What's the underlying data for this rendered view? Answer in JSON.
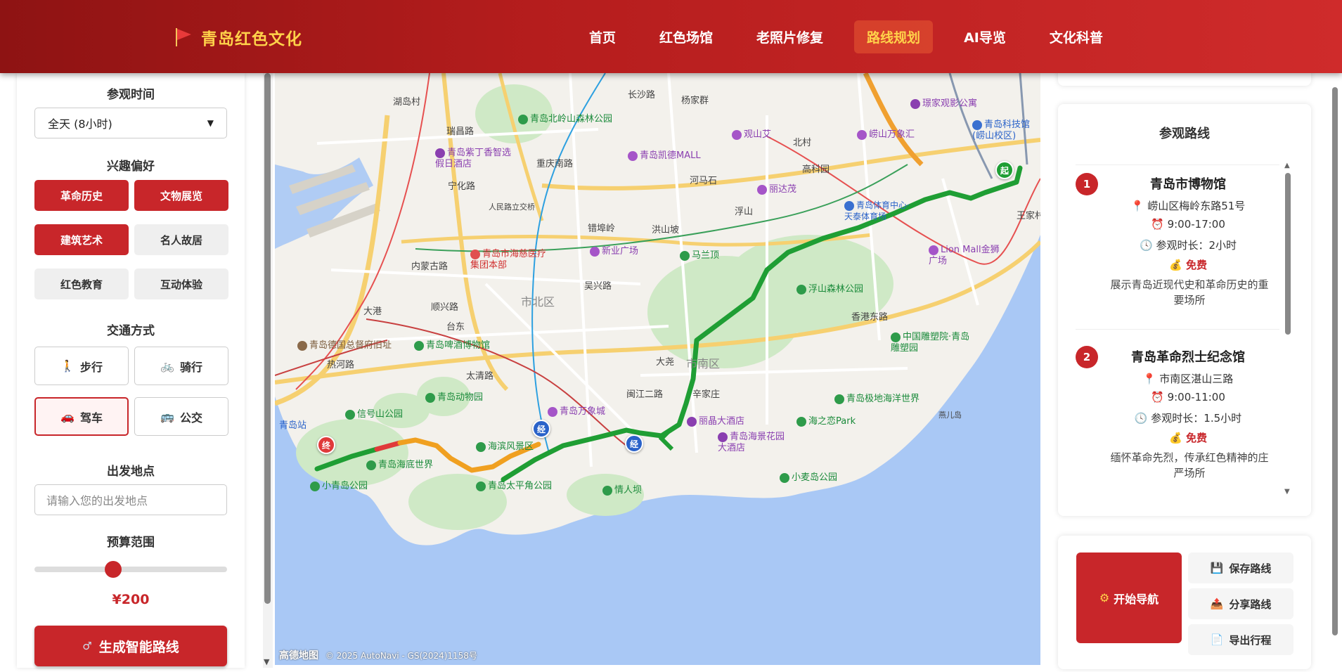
{
  "header": {
    "title": "青岛红色文化",
    "nav": [
      "首页",
      "红色场馆",
      "老照片修复",
      "路线规划",
      "AI导览",
      "文化科普"
    ],
    "active_index": 3
  },
  "left": {
    "visit_time_title": "参观时间",
    "visit_time_value": "全天 (8小时)",
    "interest_title": "兴趣偏好",
    "interests": [
      {
        "label": "革命历史",
        "selected": true
      },
      {
        "label": "文物展览",
        "selected": true
      },
      {
        "label": "建筑艺术",
        "selected": true
      },
      {
        "label": "名人故居",
        "selected": false
      },
      {
        "label": "红色教育",
        "selected": false
      },
      {
        "label": "互动体验",
        "selected": false
      }
    ],
    "transport_title": "交通方式",
    "transport": [
      {
        "label": "步行",
        "icon": "walk-icon",
        "selected": false
      },
      {
        "label": "骑行",
        "icon": "bike-icon",
        "selected": false
      },
      {
        "label": "驾车",
        "icon": "car-icon",
        "selected": true
      },
      {
        "label": "公交",
        "icon": "bus-icon",
        "selected": false
      }
    ],
    "start_title": "出发地点",
    "start_placeholder": "请输入您的出发地点",
    "budget_title": "预算范围",
    "budget_value": "¥200",
    "budget_fraction": 0.4,
    "generate_label": "生成智能路线"
  },
  "map": {
    "labels": {
      "hubei": "湖岛村",
      "ruichang": "瑞昌路",
      "ningxia": "宁化路",
      "neimenggu": "内蒙古路",
      "dagang": "大港",
      "shunxing": "顺兴路",
      "taidong": "台东",
      "rehe": "热河路",
      "taiqing": "太清路",
      "shibei": "市北区",
      "shinan": "市南区",
      "wuxing": "吴兴路",
      "hongshan": "洪山坡",
      "fushan": "浮山",
      "hemashi": "河马石",
      "changsha": "长沙路",
      "yangjia": "杨家群",
      "beicun": "北村",
      "gaoke": "高科园",
      "chongqing": "重庆南路",
      "cuoluo": "错埠岭",
      "dayao": "大尧",
      "xiangang": "香港东路",
      "xinjia": "辛家庄",
      "minjiang": "闽江二路",
      "wangjia": "王家村",
      "renmin": "人民路立交桥",
      "yanerdao": "燕儿岛",
      "qingdaozhan": "青岛站"
    },
    "pois_green": [
      "青岛北岭山森林公园",
      "马兰顶",
      "浮山森林公园",
      "青岛动物园",
      "信号山公园",
      "海滨风景区",
      "青岛海底世界",
      "小青岛公园",
      "青岛太平角公园",
      "情人坝",
      "海之恋Park",
      "小麦岛公园",
      "青岛极地海洋世界",
      "青岛啤酒博物馆",
      "中国雕塑院·青岛雕塑园"
    ],
    "pois_purple": [
      "青岛紫丁香智选假日酒店",
      "青岛凯德MALL",
      "观山艾",
      "崂山万象汇",
      "丽达茂",
      "新业广场",
      "青岛万象城",
      "丽晶大酒店",
      "青岛海景花园大酒店",
      "Lion Mall金狮广场",
      "璟家观影公寓"
    ],
    "poi_red": "青岛市海慈医疗集团本部",
    "poi_brown": "青岛德国总督府旧址",
    "poi_blue": "青岛科技馆(崂山校区)",
    "poi_sports": "青岛体育中心·天泰体育场",
    "markers": {
      "start": "起",
      "via": "经",
      "end": "终"
    },
    "copyright_brand": "高德地图",
    "copyright": "© 2025 AutoNavi - GS(2024)1158号"
  },
  "route": {
    "title": "参观路线",
    "stops": [
      {
        "num": "1",
        "name": "青岛市博物馆",
        "address": "崂山区梅岭东路51号",
        "hours": "9:00-17:00",
        "duration": "参观时长：2小时",
        "price": "免费",
        "desc": "展示青岛近现代史和革命历史的重要场所"
      },
      {
        "num": "2",
        "name": "青岛革命烈士纪念馆",
        "address": "市南区湛山三路",
        "hours": "9:00-11:00",
        "duration": "参观时长：1.5小时",
        "price": "免费",
        "desc": "缅怀革命先烈，传承红色精神的庄严场所"
      }
    ]
  },
  "actions": {
    "start_nav": "开始导航",
    "save": "保存路线",
    "share": "分享路线",
    "export": "导出行程"
  },
  "colors": {
    "brand_red": "#c8262a",
    "header_dark": "#8e1313",
    "accent_gold": "#ffd24a",
    "route_green": "#1f9e34",
    "route_orange": "#f0a020",
    "sea": "#a9c8f5"
  }
}
